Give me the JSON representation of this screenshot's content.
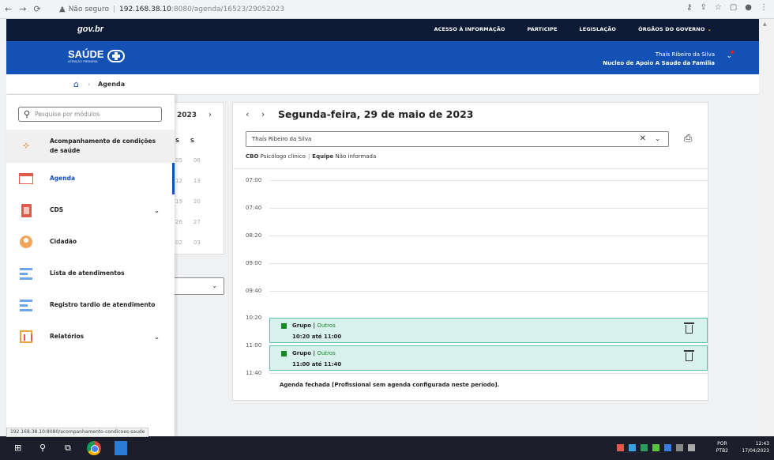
{
  "browser": {
    "insecure_label": "Não seguro",
    "url_host": "192.168.38.10",
    "url_path": ":8080/agenda/16523/29052023"
  },
  "govbar": {
    "logo": "gov.br",
    "links": [
      "ACESSO À INFORMAÇÃO",
      "PARTICIPE",
      "LEGISLAÇÃO",
      "ÓRGÃOS DO GOVERNO"
    ]
  },
  "header": {
    "brand": "SAÚDE",
    "brand_sub": "ATENÇÃO PRIMÁRIA",
    "user_name": "Thaís Ribeiro da Silva",
    "user_unit": "Nucleo de Apoio A Saude da Familia"
  },
  "breadcrumb": {
    "current": "Agenda"
  },
  "side_menu": {
    "search_placeholder": "Pesquise por módulos",
    "items": [
      {
        "label": "Acompanhamento de condições de saúde",
        "icon": "acompanhamento-icon",
        "expandable": false
      },
      {
        "label": "Agenda",
        "icon": "agenda-icon",
        "expandable": false,
        "active": true
      },
      {
        "label": "CDS",
        "icon": "cds-icon",
        "expandable": true
      },
      {
        "label": "Cidadão",
        "icon": "cidadao-icon",
        "expandable": false
      },
      {
        "label": "Lista de atendimentos",
        "icon": "lista-icon",
        "expandable": false
      },
      {
        "label": "Registro tardio de atendimento",
        "icon": "registro-icon",
        "expandable": false
      },
      {
        "label": "Relatórios",
        "icon": "relatorios-icon",
        "expandable": true
      }
    ]
  },
  "status_url": "192.168.38.10:8080/acompanhamento-condicoes-saude",
  "mini_calendar": {
    "year": "2023",
    "header": [
      "S",
      "S"
    ],
    "rows": [
      [
        "05",
        "06"
      ],
      [
        "12",
        "13"
      ],
      [
        "19",
        "20"
      ],
      [
        "26",
        "27"
      ],
      [
        "02",
        "03"
      ]
    ]
  },
  "schedule": {
    "date_title": "Segunda-feira, 29 de maio de 2023",
    "professional": "Thaís Ribeiro da Silva",
    "cbo_label": "CBO",
    "cbo_value": "Psicólogo clínico",
    "team_label": "Equipe",
    "team_value": "Não informada",
    "times": [
      "07:00",
      "07:40",
      "08:20",
      "09:00",
      "09:40",
      "10:20",
      "11:00",
      "11:40"
    ],
    "events": [
      {
        "title": "Grupo",
        "category": "Outros",
        "range": "10:20 até 11:00"
      },
      {
        "title": "Grupo",
        "category": "Outros",
        "range": "11:00 até 11:40"
      }
    ],
    "closed_message": "Agenda fechada [Profissional sem agenda configurada neste período]."
  },
  "taskbar": {
    "lang": "POR",
    "lang_sub": "PTB2",
    "time": "12:43",
    "date": "17/04/2023"
  }
}
